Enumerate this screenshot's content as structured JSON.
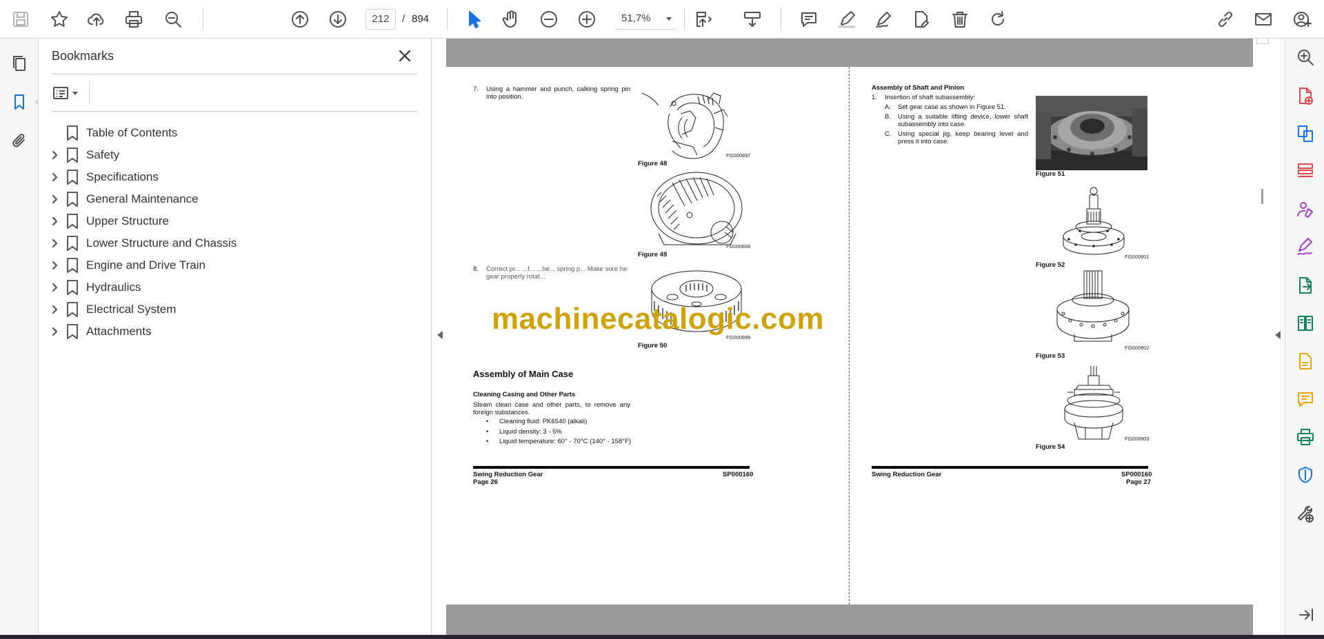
{
  "toolbar": {
    "page_current": "212",
    "page_separator": "/",
    "page_total": "894",
    "zoom_value": "51,7%",
    "icons": [
      "save-icon",
      "star-icon",
      "upload-icon",
      "print-icon",
      "find-icon",
      "page-up-icon",
      "page-down-icon",
      "select-cursor-icon",
      "hand-icon",
      "zoom-out-icon",
      "zoom-in-icon",
      "page-fit-icon",
      "scroll-mode-icon",
      "comment-icon",
      "highlight-icon",
      "sign-icon",
      "edit-icon",
      "delete-icon",
      "rotate-icon",
      "share-link-icon",
      "mail-icon",
      "account-icon"
    ]
  },
  "left_rail": {
    "icons": [
      "pages-icon",
      "bookmark-icon",
      "attachment-icon"
    ]
  },
  "bookmarks_panel": {
    "title": "Bookmarks",
    "items": [
      {
        "label": "Table of Contents",
        "expandable": false
      },
      {
        "label": "Safety",
        "expandable": true
      },
      {
        "label": "Specifications",
        "expandable": true
      },
      {
        "label": "General Maintenance",
        "expandable": true
      },
      {
        "label": "Upper Structure",
        "expandable": true
      },
      {
        "label": "Lower Structure and Chassis",
        "expandable": true
      },
      {
        "label": "Engine and Drive Train",
        "expandable": true
      },
      {
        "label": "Hydraulics",
        "expandable": true
      },
      {
        "label": "Electrical System",
        "expandable": true
      },
      {
        "label": "Attachments",
        "expandable": true
      }
    ]
  },
  "document": {
    "left_page": {
      "step7_num": "7.",
      "step7_text": "Using a hammer and punch, calking spring pin into position.",
      "fig48_code": "FG000897",
      "fig48_caption": "Figure 48",
      "fig49_code": "FG000898",
      "fig49_caption": "Figure 49",
      "step8_num": "8.",
      "step8_text": "Correct pr... ...f... ...he... spring p... Make sure he gear properly rotat...",
      "fig50_code": "FG000899",
      "fig50_caption": "Figure 50",
      "section_heading": "Assembly of Main Case",
      "subheading": "Cleaning Casing and Other Parts",
      "body": "Steam clean case and other parts, to remove any foreign substances.",
      "bullets": [
        "Cleaning fluid: PK6540 (alkali)",
        "Liquid density: 3 - 5%",
        "Liquid temperature: 60° - 70°C (140° - 158°F)"
      ],
      "footer_left": "Swing Reduction Gear",
      "footer_right": "SP000160",
      "footer_page": "Page 26"
    },
    "right_page": {
      "heading": "Assembly of Shaft and Pinion",
      "step1_num": "1.",
      "step1_text": "Insertion of shaft subassembly:",
      "substeps": [
        {
          "letter": "A.",
          "text": "Set gear case as shown in Figure 51."
        },
        {
          "letter": "B.",
          "text": "Using a suitable lifting device, lower shaft subassembly into case."
        },
        {
          "letter": "C.",
          "text": "Using special jig, keep bearing level and press it into case."
        }
      ],
      "fig51_caption": "Figure 51",
      "fig52_code": "FG000901",
      "fig52_caption": "Figure 52",
      "fig53_code": "FG000902",
      "fig53_caption": "Figure 53",
      "fig54_code": "FG000903",
      "fig54_caption": "Figure 54",
      "footer_left": "Swing Reduction Gear",
      "footer_right": "SP000160",
      "footer_page": "Page 27"
    },
    "watermark": "machinecatalogic.com"
  },
  "right_rail": {
    "tools": [
      {
        "icon": "search-zoom-icon",
        "color": "#505050"
      },
      {
        "icon": "create-pdf-icon",
        "color": "#e34850"
      },
      {
        "icon": "combine-files-icon",
        "color": "#1473e6"
      },
      {
        "icon": "organize-pages-icon",
        "color": "#e34850"
      },
      {
        "icon": "request-signature-icon",
        "color": "#a23ec8"
      },
      {
        "icon": "fill-sign-icon",
        "color": "#a23ec8"
      },
      {
        "icon": "export-pdf-icon",
        "color": "#12805c"
      },
      {
        "icon": "compare-icon",
        "color": "#12805c"
      },
      {
        "icon": "edit-pdf-icon",
        "color": "#e8a500"
      },
      {
        "icon": "comment-tool-icon",
        "color": "#e8a500"
      },
      {
        "icon": "print-production-icon",
        "color": "#12805c"
      },
      {
        "icon": "protect-icon",
        "color": "#1473e6"
      },
      {
        "icon": "more-tools-icon",
        "color": "#505050"
      },
      {
        "icon": "collapse-panel-icon",
        "color": "#505050"
      }
    ]
  }
}
